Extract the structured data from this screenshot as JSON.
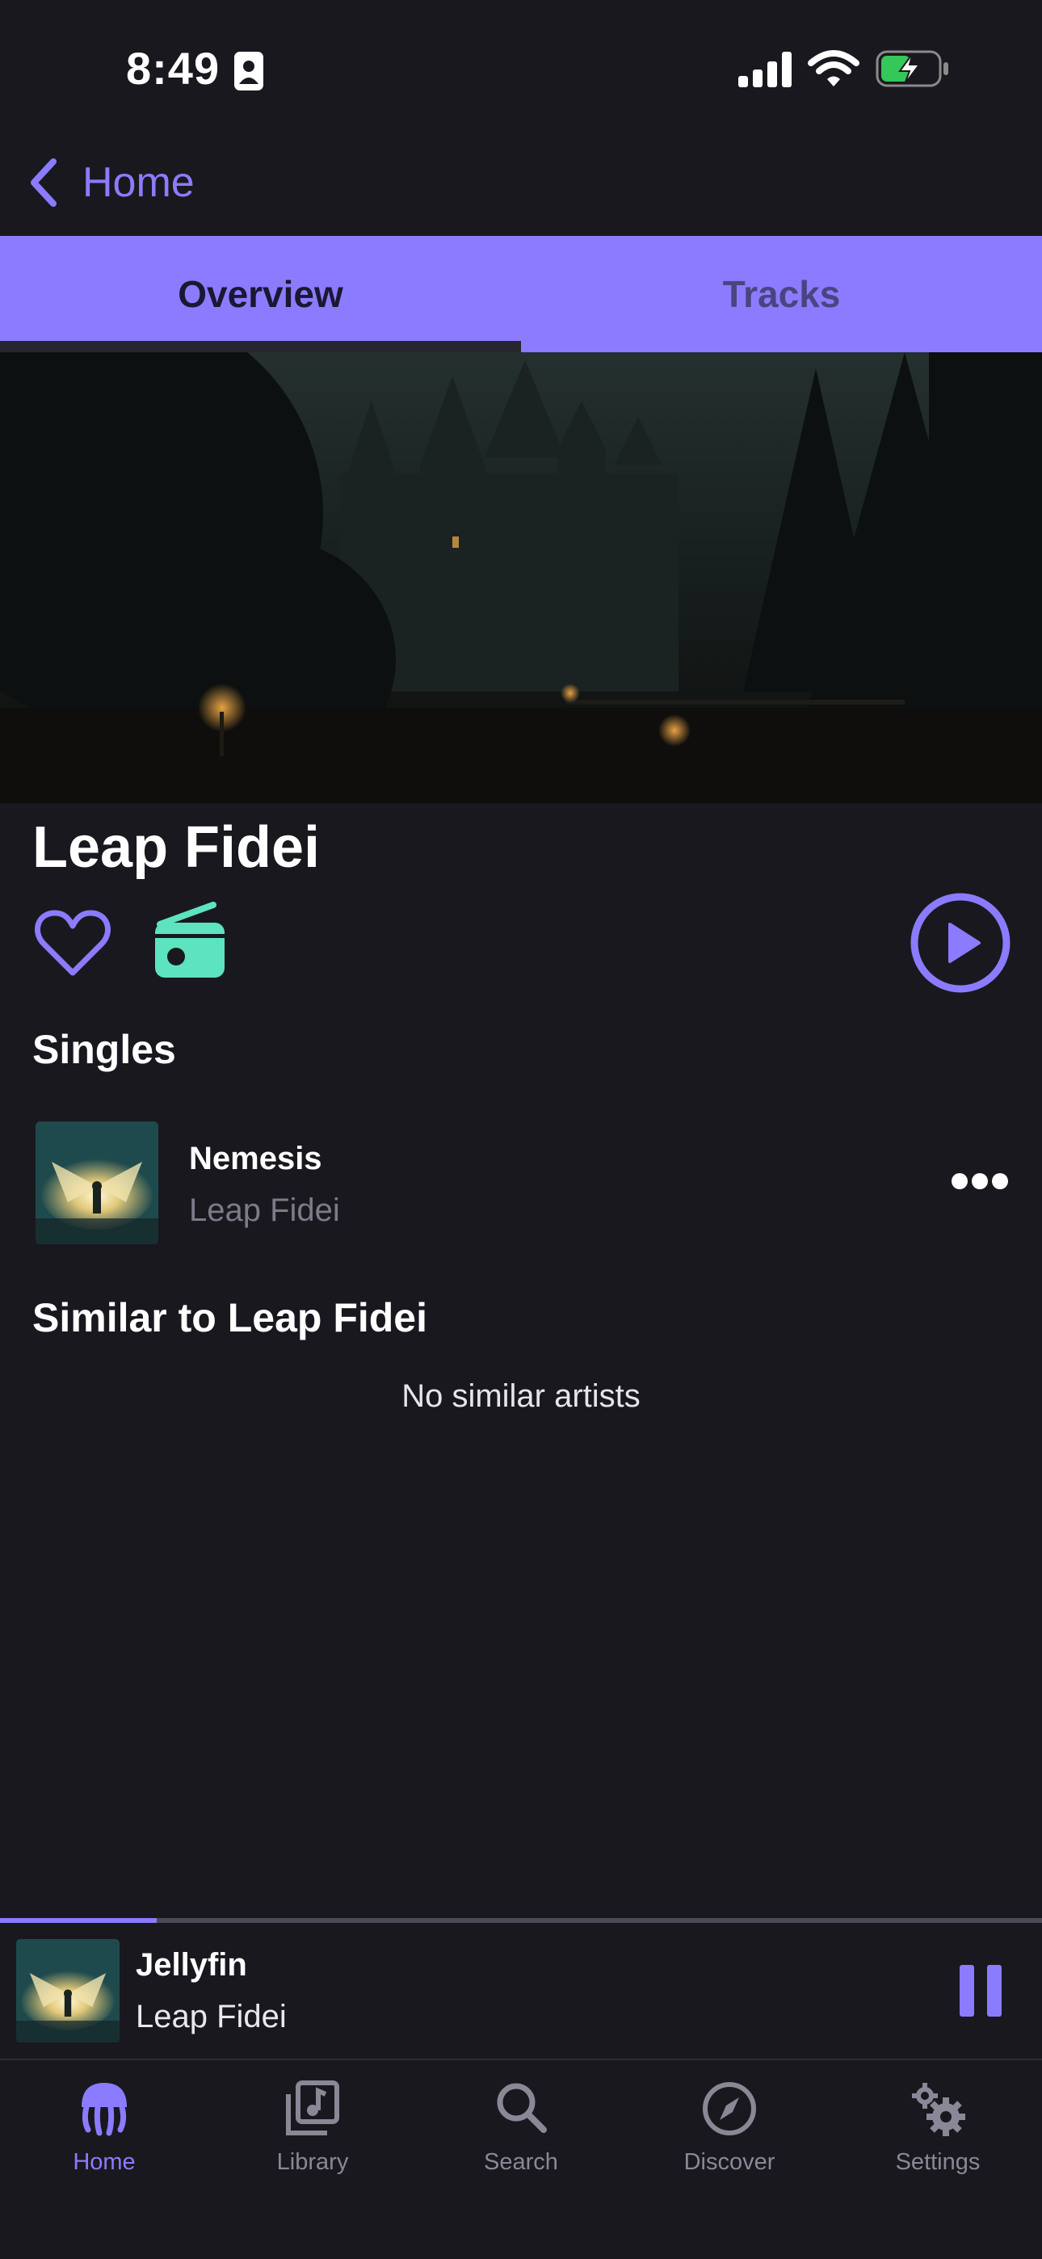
{
  "status_bar": {
    "time": "8:49"
  },
  "nav": {
    "back_label": "Home"
  },
  "tabs": [
    {
      "label": "Overview",
      "active": true
    },
    {
      "label": "Tracks",
      "active": false
    }
  ],
  "artist": {
    "name": "Leap Fidei"
  },
  "singles": {
    "title": "Singles",
    "items": [
      {
        "title": "Nemesis",
        "artist": "Leap Fidei"
      }
    ]
  },
  "similar": {
    "title": "Similar to Leap Fidei",
    "empty_text": "No similar artists"
  },
  "now_playing": {
    "title": "Jellyfin",
    "artist": "Leap Fidei",
    "progress": 0.15
  },
  "tab_bar": [
    {
      "label": "Home",
      "icon": "jellyfish-icon",
      "active": true
    },
    {
      "label": "Library",
      "icon": "library-icon",
      "active": false
    },
    {
      "label": "Search",
      "icon": "search-icon",
      "active": false
    },
    {
      "label": "Discover",
      "icon": "compass-icon",
      "active": false
    },
    {
      "label": "Settings",
      "icon": "gears-icon",
      "active": false
    }
  ],
  "colors": {
    "accent": "#8b7bff",
    "background": "#19181e",
    "radio_green": "#5de3c0",
    "battery_green": "#34c759"
  }
}
